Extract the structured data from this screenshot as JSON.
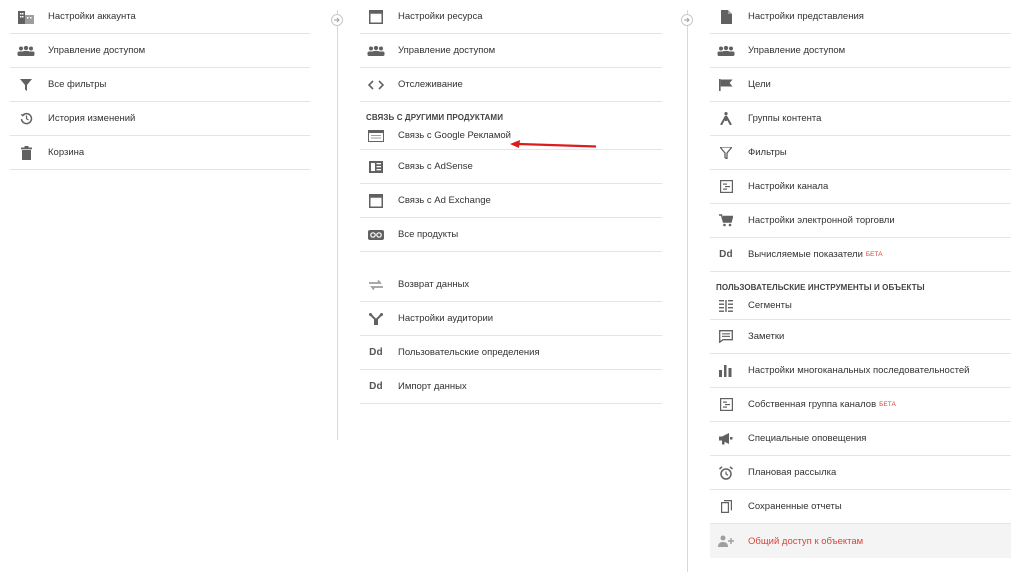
{
  "account": {
    "items": [
      {
        "icon": "building-icon",
        "label": "Настройки аккаунта"
      },
      {
        "icon": "people-icon",
        "label": "Управление доступом"
      },
      {
        "icon": "filter-icon",
        "label": "Все фильтры"
      },
      {
        "icon": "history-icon",
        "label": "История изменений"
      },
      {
        "icon": "trash-icon",
        "label": "Корзина"
      }
    ]
  },
  "property": {
    "items": [
      {
        "icon": "property-window-icon",
        "label": "Настройки ресурса"
      },
      {
        "icon": "people-icon",
        "label": "Управление доступом"
      },
      {
        "icon": "code-icon",
        "label": "Отслеживание"
      }
    ],
    "section_label": "СВЯЗЬ С ДРУГИМИ ПРОДУКТАМИ",
    "link_items": [
      {
        "icon": "google-ads-icon",
        "label": "Связь с Google Рекламой"
      },
      {
        "icon": "adsense-icon",
        "label": "Связь с AdSense"
      },
      {
        "icon": "ad-exchange-icon",
        "label": "Связь с Ad Exchange"
      },
      {
        "icon": "all-products-icon",
        "label": "Все продукты"
      }
    ],
    "other_items": [
      {
        "icon": "data-retention-icon",
        "label": "Возврат данных"
      },
      {
        "icon": "audience-icon",
        "label": "Настройки аудитории"
      },
      {
        "icon": "dd-icon",
        "label": "Пользовательские определения",
        "glyph": "Dd"
      },
      {
        "icon": "dd-icon",
        "label": "Импорт данных",
        "glyph": "Dd"
      }
    ]
  },
  "view": {
    "items": [
      {
        "icon": "document-icon",
        "label": "Настройки представления"
      },
      {
        "icon": "people-icon",
        "label": "Управление доступом"
      },
      {
        "icon": "flag-icon",
        "label": "Цели"
      },
      {
        "icon": "content-group-icon",
        "label": "Группы контента"
      },
      {
        "icon": "filter-icon",
        "label": "Фильтры"
      },
      {
        "icon": "channel-settings-icon",
        "label": "Настройки канала"
      },
      {
        "icon": "cart-icon",
        "label": "Настройки электронной торговли"
      },
      {
        "icon": "dd-icon",
        "label": "Вычисляемые показатели",
        "glyph": "Dd",
        "badge": "БЕТА"
      }
    ],
    "section_label": "ПОЛЬЗОВАТЕЛЬСКИЕ ИНСТРУМЕНТЫ И ОБЪЕКТЫ",
    "tool_items": [
      {
        "icon": "segments-icon",
        "label": "Сегменты"
      },
      {
        "icon": "notes-icon",
        "label": "Заметки"
      },
      {
        "icon": "bar-chart-icon",
        "label": "Настройки многоканальных последовательностей"
      },
      {
        "icon": "channel-settings-icon",
        "label": "Собственная группа каналов",
        "badge": "БЕТА"
      },
      {
        "icon": "megaphone-icon",
        "label": "Специальные оповещения"
      },
      {
        "icon": "alarm-clock-icon",
        "label": "Плановая рассылка"
      },
      {
        "icon": "saved-reports-icon",
        "label": "Сохраненные отчеты"
      },
      {
        "icon": "share-user-icon",
        "label": "Общий доступ к объектам"
      }
    ]
  },
  "colors": {
    "accent_red": "#db4437",
    "icon_gray": "#616161",
    "divider": "#e4e4e4"
  }
}
